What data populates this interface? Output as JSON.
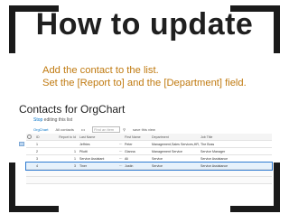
{
  "slide": {
    "title": "How to update",
    "instructions": [
      "Add the contact to the list.",
      "Set the [Report to] and the [Department] field."
    ]
  },
  "list": {
    "title": "Contacts for OrgChart",
    "stop_editing_prefix": "Stop",
    "stop_editing_rest": " editing this list",
    "toolbar": {
      "view": "OrgChart",
      "all_contacts": "All contacts",
      "ellipsis": "•••",
      "find_placeholder": "Find an item",
      "save": "save this view"
    },
    "columns": {
      "id": "ID",
      "report_to": "Report to Id",
      "last_name": "Last Name",
      "first_name": "First Name",
      "department": "Department",
      "job_title": "Job Title"
    },
    "rows": [
      {
        "id": "1",
        "report_to": "",
        "last_name": "Jeffries",
        "first_name": "Peter",
        "department": "Management,Sales Services,HR,Office",
        "job_title": "The Boss"
      },
      {
        "id": "2",
        "report_to": "1",
        "last_name": "Pilotti",
        "first_name": "Gianna",
        "department": "Management Service",
        "job_title": "Service Manager"
      },
      {
        "id": "3",
        "report_to": "1",
        "last_name": "Service Assistant",
        "first_name": "Ali",
        "department": "Service",
        "job_title": "Service Assistance"
      },
      {
        "id": "4",
        "report_to": "3",
        "last_name": "Tiner",
        "first_name": "Justin",
        "department": "Service",
        "job_title": "Service Assistance"
      }
    ]
  },
  "colors": {
    "accent": "#c07a10",
    "link": "#0072c6",
    "selection": "#2f7bd1"
  }
}
